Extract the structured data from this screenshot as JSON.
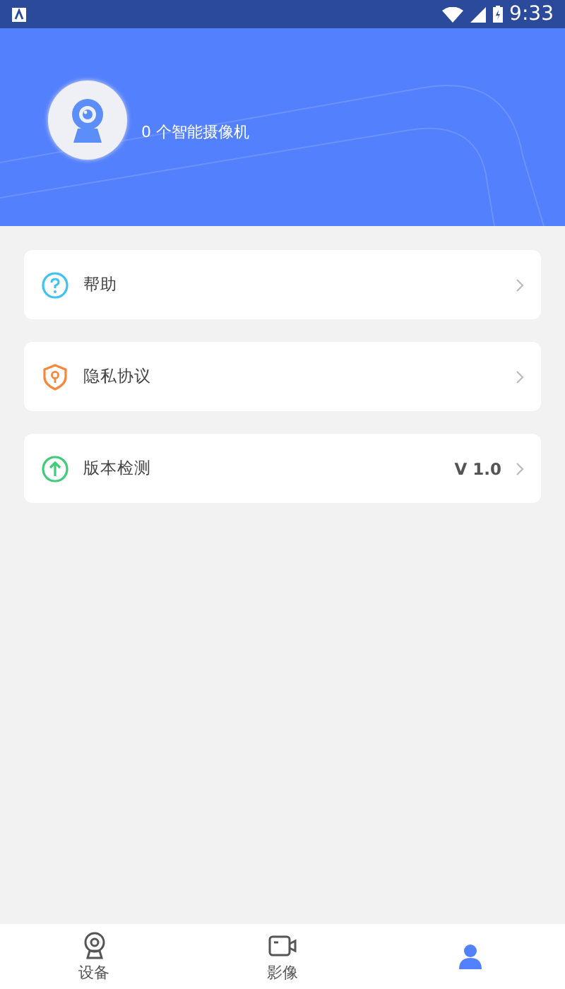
{
  "status_bar": {
    "time": "9:33"
  },
  "header": {
    "camera_count": "0 个智能摄像机"
  },
  "menu": [
    {
      "kind": "help",
      "label": "帮助",
      "color": "#3fc1f2"
    },
    {
      "kind": "privacy",
      "label": "隐私协议",
      "color": "#f7873b"
    },
    {
      "kind": "version",
      "label": "版本检测",
      "color": "#3ecb7a",
      "value": "V 1.0"
    }
  ],
  "tabs": [
    {
      "kind": "device",
      "label": "设备",
      "selected": false
    },
    {
      "kind": "media",
      "label": "影像",
      "selected": false
    },
    {
      "kind": "profile",
      "selected": true
    }
  ]
}
